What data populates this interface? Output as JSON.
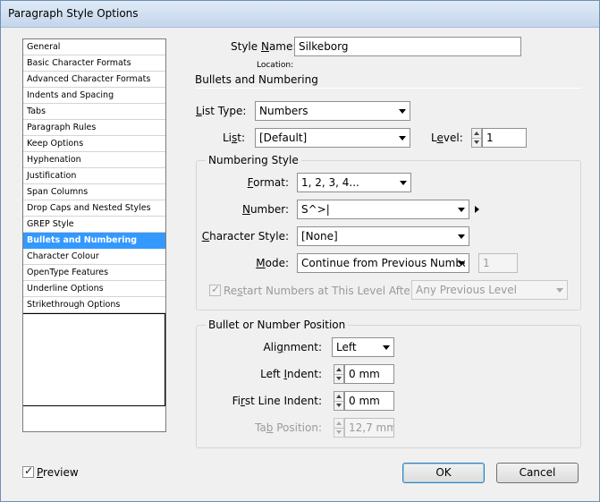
{
  "window": {
    "title": "Paragraph Style Options"
  },
  "sidebar": {
    "items": [
      {
        "label": "General"
      },
      {
        "label": "Basic Character Formats"
      },
      {
        "label": "Advanced Character Formats"
      },
      {
        "label": "Indents and Spacing"
      },
      {
        "label": "Tabs"
      },
      {
        "label": "Paragraph Rules"
      },
      {
        "label": "Keep Options"
      },
      {
        "label": "Hyphenation"
      },
      {
        "label": "Justification"
      },
      {
        "label": "Span Columns"
      },
      {
        "label": "Drop Caps and Nested Styles"
      },
      {
        "label": "GREP Style"
      },
      {
        "label": "Bullets and Numbering",
        "selected": true
      },
      {
        "label": "Character Colour"
      },
      {
        "label": "OpenType Features"
      },
      {
        "label": "Underline Options"
      },
      {
        "label": "Strikethrough Options"
      }
    ]
  },
  "style_name": {
    "label_prefix": "Style ",
    "label_accel": "N",
    "label_suffix": "ame:",
    "value": "Silkeborg",
    "location_label": "Location:"
  },
  "section": {
    "title": "Bullets and Numbering"
  },
  "list_type": {
    "label_accel": "L",
    "label_suffix": "ist Type:",
    "value": "Numbers"
  },
  "list": {
    "label_prefix": "Li",
    "label_accel": "s",
    "label_suffix": "t:",
    "value": "[Default]"
  },
  "level": {
    "label_prefix": "L",
    "label_accel": "e",
    "label_suffix": "vel:",
    "value": "1"
  },
  "numbering_style": {
    "title": "Numbering Style",
    "format": {
      "label_accel": "F",
      "label_suffix": "ormat:",
      "value": "1, 2, 3, 4..."
    },
    "number": {
      "label_accel": "N",
      "label_suffix": "umber:",
      "value": "S^>|"
    },
    "character_style": {
      "label_accel": "C",
      "label_suffix": "haracter Style:",
      "value": "[None]"
    },
    "mode": {
      "label_accel": "M",
      "label_suffix": "ode:",
      "value": "Continue from Previous Numbe",
      "start_value": "1"
    },
    "restart": {
      "label_prefix": "Re",
      "label_accel": "s",
      "label_suffix": "tart Numbers at This Level After:",
      "checked": true,
      "value": "Any Previous Level"
    }
  },
  "position": {
    "title": "Bullet or Number Position",
    "alignment": {
      "label_prefix": "Ali",
      "label_accel": "g",
      "label_suffix": "nment:",
      "value": "Left"
    },
    "left_indent": {
      "label_prefix": "Left ",
      "label_accel": "I",
      "label_suffix": "ndent:",
      "value": "0 mm"
    },
    "first_line_indent": {
      "label_prefix": "Fi",
      "label_accel": "r",
      "label_suffix": "st Line Indent:",
      "value": "0 mm"
    },
    "tab_position": {
      "label_prefix": "Ta",
      "label_accel": "b",
      "label_suffix": " Position:",
      "value": "12,7 mm"
    }
  },
  "footer": {
    "preview": {
      "label_accel": "P",
      "label_suffix": "review",
      "checked": true
    },
    "ok_label": "OK",
    "cancel_label": "Cancel"
  },
  "icons": {
    "checkmark": "✓"
  }
}
